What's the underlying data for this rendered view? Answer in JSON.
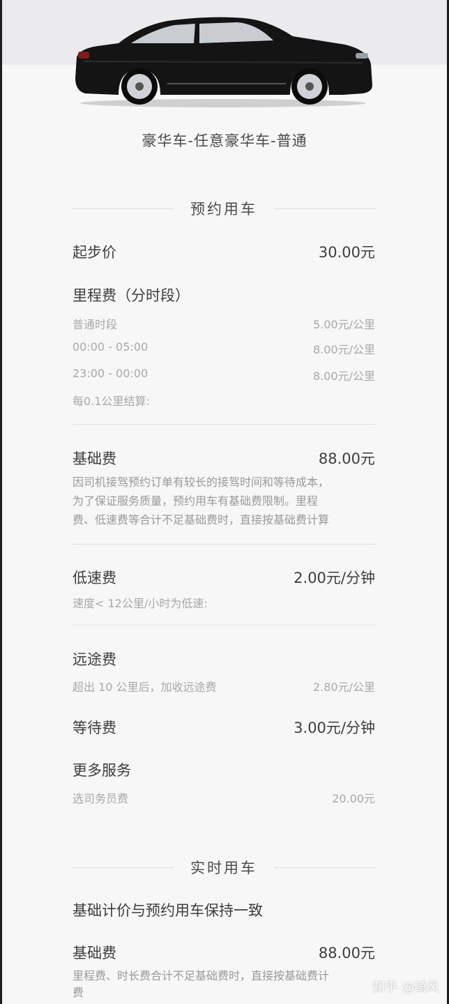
{
  "vehicle_type": "豪华车-任意豪华车-普通",
  "reservation": {
    "title": "预约用车",
    "start_price": {
      "label": "起步价",
      "value": "30.00元"
    },
    "mileage": {
      "label": "里程费（分时段）",
      "rows": [
        {
          "label": "普通时段",
          "value": "5.00元/公里"
        },
        {
          "label": "00:00 - 05:00",
          "value": "8.00元/公里"
        },
        {
          "label": "23:00 - 00:00",
          "value": "8.00元/公里"
        }
      ],
      "note": "每0.1公里结算:"
    },
    "base_fee": {
      "label": "基础费",
      "value": "88.00元",
      "desc": [
        "因司机接驾预约订单有较长的接驾时间和等待成本，",
        "为了保证服务质量，预约用车有基础费限制。里程",
        "费、低速费等合计不足基础费时，直接按基础费计算"
      ]
    },
    "low_speed": {
      "label": "低速费",
      "value": "2.00元/分钟",
      "note": "速度< 12公里/小时为低速:"
    },
    "long_distance": {
      "label": "远途费",
      "note": "超出 10 公里后，加收远途费",
      "value": "2.80元/公里"
    },
    "waiting": {
      "label": "等待费",
      "value": "3.00元/分钟"
    },
    "more_services": {
      "label": "更多服务",
      "item": "选司务员费",
      "value": "20.00元"
    }
  },
  "realtime": {
    "title": "实时用车",
    "note": "基础计价与预约用车保持一致",
    "base_fee": {
      "label": "基础费",
      "value": "88.00元",
      "desc": [
        "里程费、时长费合计不足基础费时，直接按基础费计",
        "费"
      ]
    }
  },
  "watermark": "知乎 @绮风"
}
